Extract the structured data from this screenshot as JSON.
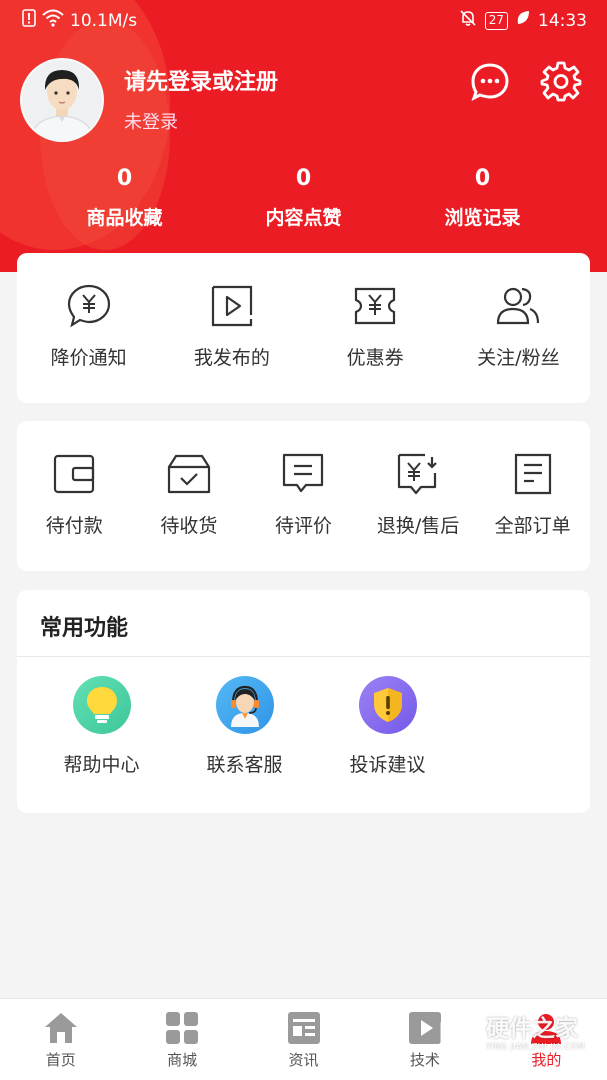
{
  "status_bar": {
    "network_speed": "10.1M/s",
    "battery": "27",
    "time": "14:33"
  },
  "profile": {
    "title": "请先登录或注册",
    "subtitle": "未登录"
  },
  "stats": [
    {
      "value": "0",
      "label": "商品收藏"
    },
    {
      "value": "0",
      "label": "内容点赞"
    },
    {
      "value": "0",
      "label": "浏览记录"
    }
  ],
  "quick_links": [
    {
      "label": "降价通知",
      "icon": "price-drop-icon"
    },
    {
      "label": "我发布的",
      "icon": "video-icon"
    },
    {
      "label": "优惠券",
      "icon": "coupon-icon"
    },
    {
      "label": "关注/粉丝",
      "icon": "users-icon"
    }
  ],
  "orders": [
    {
      "label": "待付款",
      "icon": "wallet-icon"
    },
    {
      "label": "待收货",
      "icon": "box-icon"
    },
    {
      "label": "待评价",
      "icon": "comment-icon"
    },
    {
      "label": "退换/售后",
      "icon": "refund-icon"
    },
    {
      "label": "全部订单",
      "icon": "order-list-icon"
    }
  ],
  "common": {
    "title": "常用功能",
    "items": [
      {
        "label": "帮助中心",
        "icon": "lightbulb-icon",
        "color": "#46d3a4"
      },
      {
        "label": "联系客服",
        "icon": "agent-icon",
        "color": "#3aa7ee"
      },
      {
        "label": "投诉建议",
        "icon": "shield-icon",
        "color": "#8a6df0"
      }
    ]
  },
  "bottom_nav": [
    {
      "label": "首页",
      "icon": "home-icon"
    },
    {
      "label": "商城",
      "icon": "grid-icon"
    },
    {
      "label": "资讯",
      "icon": "news-icon"
    },
    {
      "label": "技术",
      "icon": "play-icon"
    },
    {
      "label": "我的",
      "icon": "profile-icon"
    }
  ],
  "watermark": {
    "text": "硬件之家",
    "sub": "YING JIAN ZHI JIA.COM"
  },
  "colors": {
    "brand": "#ec1c24",
    "background": "#f4f4f4"
  }
}
